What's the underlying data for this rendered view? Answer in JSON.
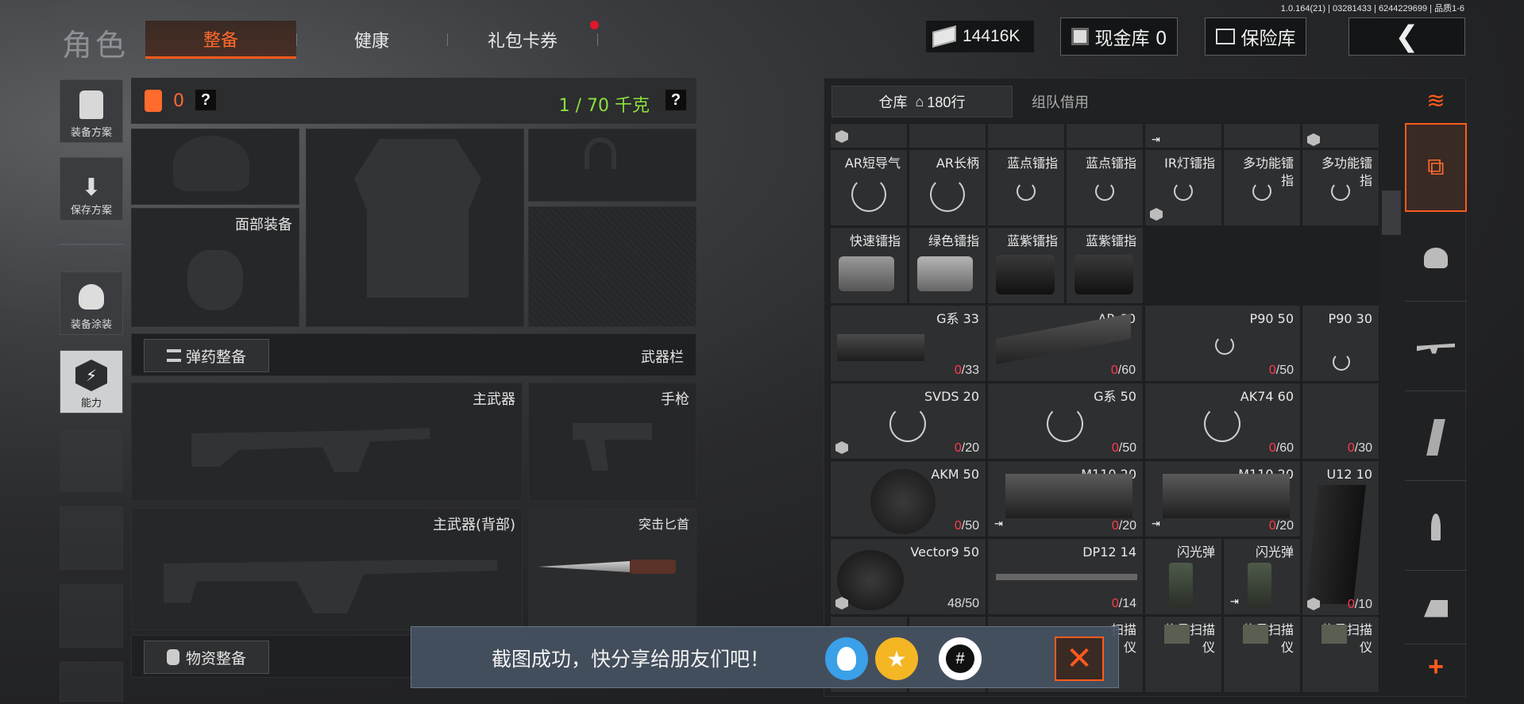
{
  "header": {
    "version": "1.0.164(21) | 03281433 | 6244229699 | 品质1-6",
    "title": "角色",
    "tabs": [
      {
        "label": "整备"
      },
      {
        "label": "健康"
      },
      {
        "label": "礼包卡券"
      }
    ],
    "money": "14416K",
    "cash_vault": "现金库 0",
    "insurance_vault": "保险库",
    "back": "❮"
  },
  "sidebar": [
    {
      "label": "装备方案"
    },
    {
      "label": "保存方案"
    },
    {
      "label": "装备涂装"
    },
    {
      "label": "能力"
    }
  ],
  "loadout": {
    "armor_count": "0",
    "weight": "1 / 70 千克",
    "question": "?",
    "face_label": "面部装备",
    "ammo_button": "弹药整备",
    "weapon_bar": "武器栏",
    "primary": "主武器",
    "pistol": "手枪",
    "primary_back": "主武器(背部)",
    "knife": "突击匕首",
    "supply_button": "物资整备"
  },
  "warehouse": {
    "tab_warehouse": "仓库",
    "rows": "180行",
    "tab_team": "组队借用",
    "items": [
      {
        "name": "AR短导气"
      },
      {
        "name": "AR长柄"
      },
      {
        "name": "蓝点镭指"
      },
      {
        "name": "蓝点镭指"
      },
      {
        "name": "IR灯镭指"
      },
      {
        "name": "多功能镭指"
      },
      {
        "name": "多功能镭指"
      },
      {
        "name": "快速镭指"
      },
      {
        "name": "绿色镭指"
      },
      {
        "name": "蓝紫镭指"
      },
      {
        "name": "蓝紫镭指"
      },
      {
        "name": "G系 33",
        "have": "0",
        "total": "/33"
      },
      {
        "name": "AR 60",
        "have": "0",
        "total": "/60"
      },
      {
        "name": "P90 50",
        "have": "0",
        "total": "/50"
      },
      {
        "name": "P90 30"
      },
      {
        "name": "SVDS 20",
        "have": "0",
        "total": "/20"
      },
      {
        "name": "G系 50",
        "have": "0",
        "total": "/50"
      },
      {
        "name": "AK74 60",
        "have": "0",
        "total": "/60"
      },
      {
        "have": "0",
        "total": "/30"
      },
      {
        "name": "AKM 50",
        "have": "0",
        "total": "/50"
      },
      {
        "name": "M110 20",
        "have": "0",
        "total": "/20"
      },
      {
        "name": "M110 20",
        "have": "0",
        "total": "/20"
      },
      {
        "name": "U12 10"
      },
      {
        "name": "Vector9 50",
        "plain": "48/50"
      },
      {
        "name": "DP12 14",
        "have": "0",
        "total": "/14"
      },
      {
        "name": "闪光弹"
      },
      {
        "name": "闪光弹"
      },
      {
        "have": "0",
        "total": "/10"
      },
      {
        "name": "扫描仪"
      },
      {
        "name": "信号扫描仪"
      },
      {
        "name": "信号扫描仪"
      },
      {
        "name": "信号扫描仪"
      }
    ]
  },
  "toast": {
    "text": "截图成功，快分享给朋友们吧！"
  },
  "colors": {
    "accent": "#ff5a1c",
    "count_red": "#ff3a4c",
    "weight_green": "#8be040"
  }
}
